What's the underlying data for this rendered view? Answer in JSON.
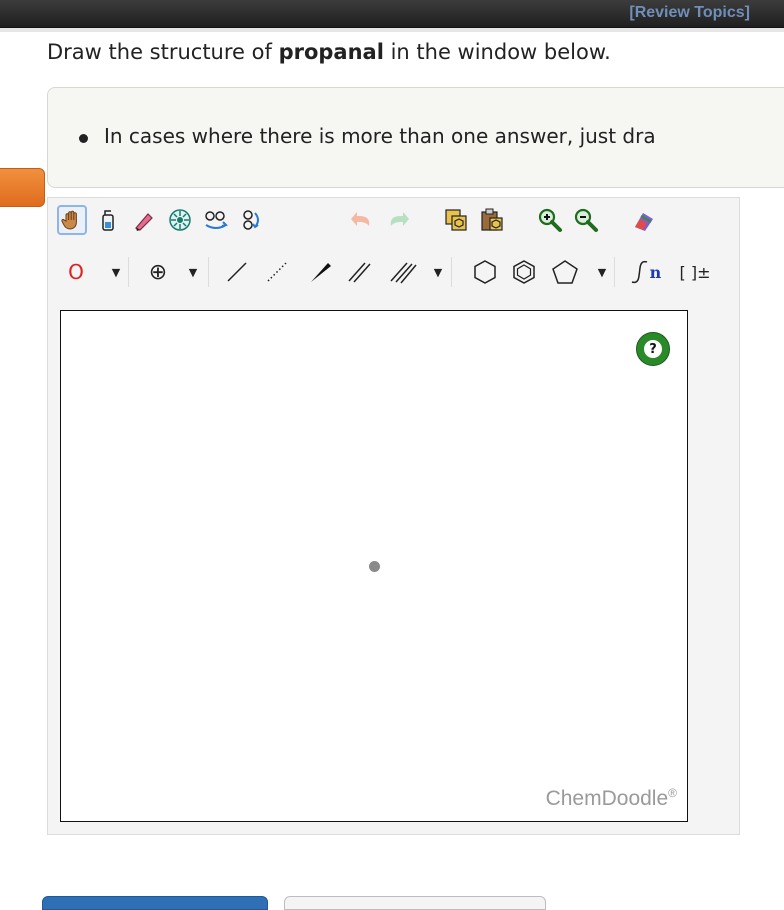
{
  "header": {
    "review_link": "[Review Topics]"
  },
  "question": {
    "prefix": "Draw the structure of ",
    "compound": "propanal",
    "suffix": " in the window below."
  },
  "hint": {
    "item": "In cases where there is more than one answer, just dra"
  },
  "toolbar": {
    "row1_icons": [
      "hand-icon",
      "eraser-bottle-icon",
      "pencil-eraser-icon",
      "center-icon",
      "flip-icon",
      "rotate-icon",
      "undo-icon",
      "redo-icon",
      "copy-icon",
      "paste-icon",
      "zoom-in-icon",
      "zoom-out-icon",
      "clean-icon"
    ],
    "atom_label": "O",
    "charge_symbol": "⊕",
    "bracket_label": "[ ]±",
    "chain_label": "n"
  },
  "canvas": {
    "help_label": "?",
    "brand": "ChemDoodle",
    "brand_mark": "®"
  },
  "colors": {
    "accent_orange": "#e9802c",
    "primary_blue": "#2e6fb5",
    "help_green": "#2a8a2a",
    "link_blue": "#6f8fb8"
  }
}
